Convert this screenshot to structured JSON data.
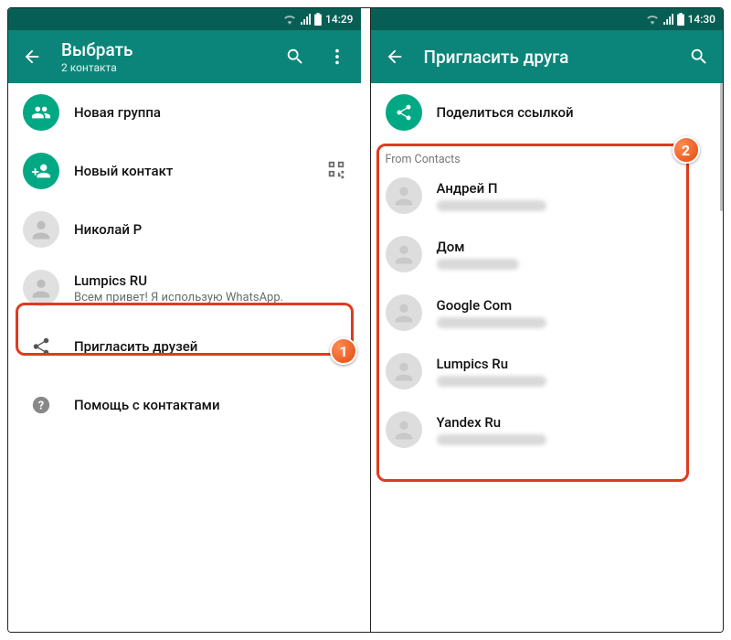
{
  "left": {
    "status": {
      "time": "14:29"
    },
    "appbar": {
      "title": "Выбрать",
      "subtitle": "2 контакта"
    },
    "rows": {
      "new_group": "Новая группа",
      "new_contact": "Новый контакт",
      "nikolay": "Николай Р",
      "lumpics": "Lumpics RU",
      "lumpics_status": "Всем привет! Я использую WhatsApp.",
      "invite": "Пригласить друзей",
      "help": "Помощь с контактами"
    },
    "annotation_number": "1"
  },
  "right": {
    "status": {
      "time": "14:30"
    },
    "appbar": {
      "title": "Пригласить друга"
    },
    "share_link": "Поделиться ссылкой",
    "section": "From Contacts",
    "contacts": [
      {
        "name": "Андрей П"
      },
      {
        "name": "Дом"
      },
      {
        "name": "Google Com"
      },
      {
        "name": "Lumpics Ru"
      },
      {
        "name": "Yandex Ru"
      }
    ],
    "annotation_number": "2"
  }
}
